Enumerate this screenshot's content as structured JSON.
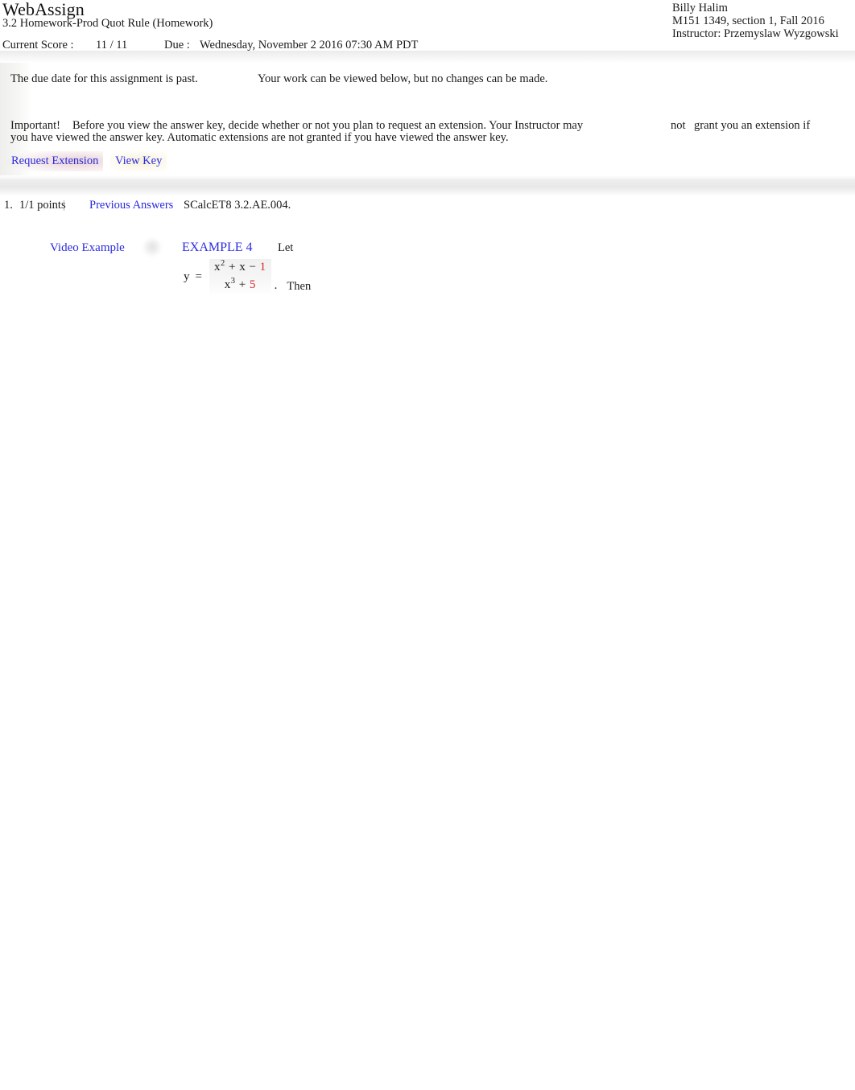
{
  "header": {
    "app_title": "WebAssign",
    "assignment_title": "3.2 Homework-Prod Quot Rule (Homework)",
    "student_name": "Billy Halim",
    "course_line": "M151 1349, section 1, Fall 2016",
    "instructor_line": "Instructor: Przemyslaw Wyzgowski"
  },
  "score_row": {
    "current_score_label": "Current Score :",
    "current_score_value": "11 / 11",
    "due_label": "Due :",
    "due_value": "Wednesday, November 2 2016 07:30 AM PDT"
  },
  "notice": {
    "past_due": "The due date for this assignment is past.",
    "view_only": "Your work can be viewed below, but no changes can be made.",
    "important_label": "Important!",
    "important_part_a": "Before you view the answer key, decide whether or not you plan to request an extension. Your Instructor may",
    "important_not": "not",
    "important_part_b": "grant you an extension if",
    "important_line2": "you have viewed the answer key. Automatic extensions are not granted if you have viewed the answer key."
  },
  "actions": {
    "request_extension_label": "Request Extension",
    "view_key_label": "View Key"
  },
  "question": {
    "number": "1.",
    "points": "1/1 points",
    "pipe": "|",
    "previous_answers_label": "Previous Answers",
    "code": "SCalcET8 3.2.AE.004."
  },
  "example": {
    "video_example_label": "Video Example",
    "video_icon_name": "video-play-icon",
    "example_label": "EXAMPLE 4",
    "let_text": "Let",
    "then_text": "Then",
    "period": ".",
    "equation": {
      "lhs": "y",
      "equals": "=",
      "numerator_plain": "x² + x − ",
      "numerator_base1": "x",
      "numerator_exp1": "2",
      "numerator_op1": "+",
      "numerator_term2": "x",
      "numerator_op2": "−",
      "numerator_red": "1",
      "denominator_base": "x",
      "denominator_exp": "3",
      "denominator_op": "+",
      "denominator_red": "5"
    }
  },
  "colors": {
    "link": "#2b2be0",
    "math_red": "#d4282b",
    "text": "#1a1a1a"
  }
}
